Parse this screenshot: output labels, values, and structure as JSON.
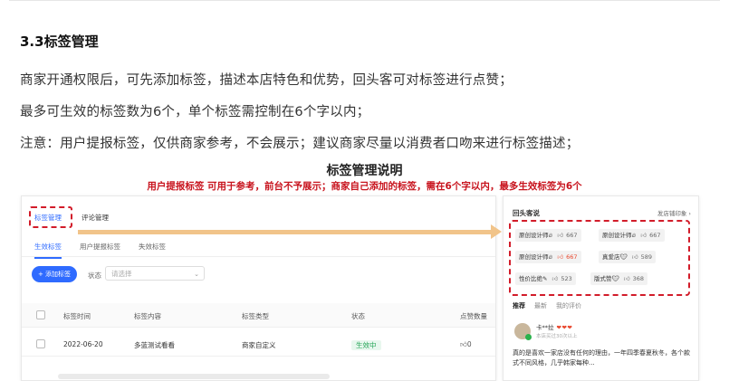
{
  "section_title": "3.3标签管理",
  "paragraphs": [
    "商家开通权限后，可先添加标签，描述本店特色和优势，回头客可对标签进行点赞；",
    "最多可生效的标签数为6个，单个标签需控制在6个字以内；",
    "注意：用户提报标签，仅供商家参考，不会展示；建议商家尽量以消费者口吻来进行标签描述；"
  ],
  "figure": {
    "title": "标签管理说明",
    "subtitle": "用户提报标签 可用于参考，前台不予展示；商家自己添加的标签，需在6个字以内，最多生效标签为6个"
  },
  "admin": {
    "top_tabs": [
      "标签管理",
      "评论管理"
    ],
    "sub_tabs": [
      "生效标签",
      "用户提报标签",
      "失效标签"
    ],
    "add_button": "+ 添加标签",
    "filter_label": "状态",
    "filter_placeholder": "请选择",
    "columns": [
      "标签时间",
      "标签内容",
      "标签类型",
      "状态",
      "点赞数量"
    ],
    "rows": [
      {
        "time": "2022-06-20",
        "content": "多蓝测试看看",
        "type": "商家自定义",
        "status": "生效中",
        "likes": "0"
      }
    ]
  },
  "phone": {
    "title": "回头客说",
    "link": "发店铺印象 ›",
    "tags": [
      {
        "label": "原创设计师",
        "count": "667",
        "hot": false
      },
      {
        "label": "原创设计师",
        "count": "667",
        "hot": false
      },
      {
        "label": "原创设计师",
        "count": "667",
        "hot": false
      },
      {
        "label": "原创设计师",
        "count": "667",
        "hot": true
      },
      {
        "label": "真爱店",
        "count": "589",
        "hot": false
      },
      {
        "label": "性价比绝",
        "count": "523",
        "hot": false
      },
      {
        "label": "版式赞",
        "count": "368",
        "hot": false
      }
    ],
    "tabs": [
      "推荐",
      "最新",
      "我的评价"
    ],
    "user": "卡**拉",
    "hearts": "❤❤❤",
    "meta": "本店买过30次以上",
    "review": "真的是喜欢一家店没有任何的理由，一年四季春夏秋冬，各个款式不同风格，几乎韩家每种..."
  }
}
